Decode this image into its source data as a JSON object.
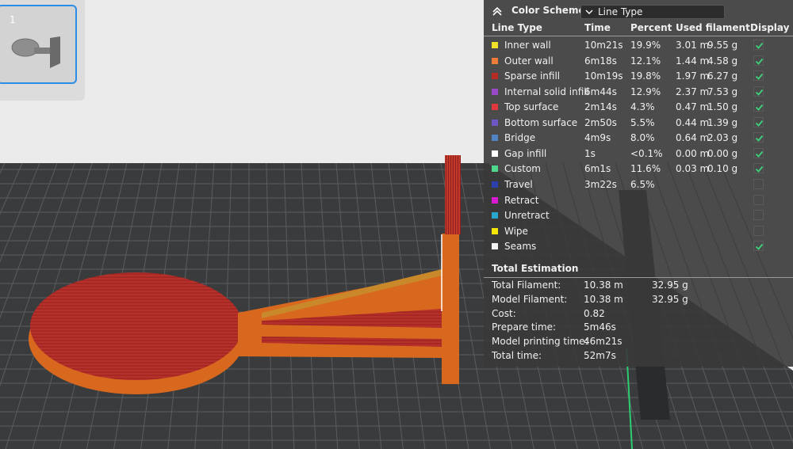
{
  "plate": {
    "thumbnail": {
      "number": "1"
    }
  },
  "color_scheme": {
    "title": "Color Scheme",
    "dropdown_value": "Line Type",
    "columns": [
      "Line Type",
      "Time",
      "Percent",
      "Used filament",
      "Display"
    ],
    "rows": [
      {
        "name": "Inner wall",
        "color": "#f2e12b",
        "time": "10m21s",
        "percent": "19.9%",
        "meters": "3.01 m",
        "grams": "9.55 g",
        "display": true
      },
      {
        "name": "Outer wall",
        "color": "#f07c3a",
        "time": "6m18s",
        "percent": "12.1%",
        "meters": "1.44 m",
        "grams": "4.58 g",
        "display": true
      },
      {
        "name": "Sparse infill",
        "color": "#b52b25",
        "time": "10m19s",
        "percent": "19.8%",
        "meters": "1.97 m",
        "grams": "6.27 g",
        "display": true
      },
      {
        "name": "Internal solid infill",
        "color": "#9b49c9",
        "time": "6m44s",
        "percent": "12.9%",
        "meters": "2.37 m",
        "grams": "7.53 g",
        "display": true
      },
      {
        "name": "Top surface",
        "color": "#e2393f",
        "time": "2m14s",
        "percent": "4.3%",
        "meters": "0.47 m",
        "grams": "1.50 g",
        "display": true
      },
      {
        "name": "Bottom surface",
        "color": "#6c57c4",
        "time": "2m50s",
        "percent": "5.5%",
        "meters": "0.44 m",
        "grams": "1.39 g",
        "display": true
      },
      {
        "name": "Bridge",
        "color": "#4f83c4",
        "time": "4m9s",
        "percent": "8.0%",
        "meters": "0.64 m",
        "grams": "2.03 g",
        "display": true
      },
      {
        "name": "Gap infill",
        "color": "#ffffff",
        "time": "1s",
        "percent": "<0.1%",
        "meters": "0.00 m",
        "grams": "0.00 g",
        "display": true
      },
      {
        "name": "Custom",
        "color": "#4fd68f",
        "time": "6m1s",
        "percent": "11.6%",
        "meters": "0.03 m",
        "grams": "0.10 g",
        "display": true
      },
      {
        "name": "Travel",
        "color": "#2b3fae",
        "time": "3m22s",
        "percent": "6.5%",
        "meters": "",
        "grams": "",
        "display": false
      },
      {
        "name": "Retract",
        "color": "#d81bd1",
        "time": "",
        "percent": "",
        "meters": "",
        "grams": "",
        "display": false
      },
      {
        "name": "Unretract",
        "color": "#2aa6cf",
        "time": "",
        "percent": "",
        "meters": "",
        "grams": "",
        "display": false
      },
      {
        "name": "Wipe",
        "color": "#f5e50a",
        "time": "",
        "percent": "",
        "meters": "",
        "grams": "",
        "display": false
      },
      {
        "name": "Seams",
        "color": "#f2f2f2",
        "time": "",
        "percent": "",
        "meters": "",
        "grams": "",
        "display": true
      }
    ]
  },
  "total_estimation": {
    "title": "Total Estimation",
    "rows": [
      {
        "label": "Total Filament:",
        "value": "10.38 m",
        "value2": "32.95 g"
      },
      {
        "label": "Model Filament:",
        "value": "10.38 m",
        "value2": "32.95 g"
      },
      {
        "label": "Cost:",
        "value": "0.82",
        "value2": ""
      },
      {
        "label": "Prepare time:",
        "value": "5m46s",
        "value2": ""
      },
      {
        "label": "Model printing time:",
        "value": "46m21s",
        "value2": ""
      },
      {
        "label": "Total time:",
        "value": "52m7s",
        "value2": ""
      }
    ]
  },
  "colors": {
    "accent": "#2b8ee6",
    "model_outer": "#d9681f",
    "model_infill": "#b52b25",
    "bed": "#3a3b3d",
    "check": "#3fd07a"
  }
}
